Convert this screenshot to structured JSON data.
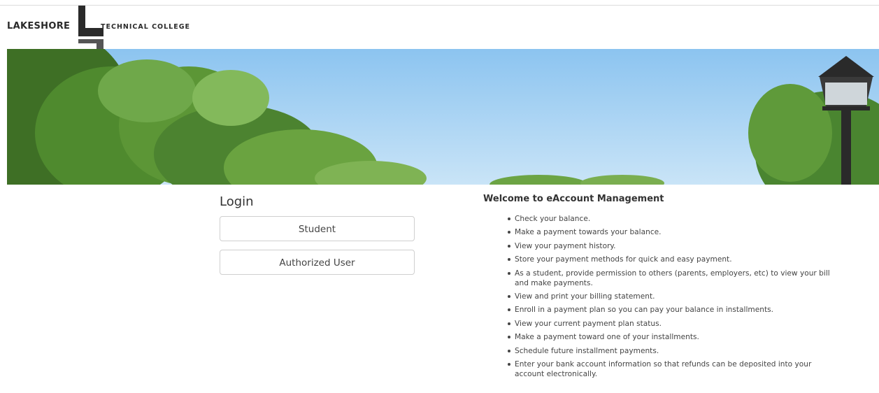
{
  "header": {
    "logo_left": "LAKESHORE",
    "logo_right": "TECHNICAL COLLEGE"
  },
  "banner": {
    "description_icon": "campus-trees-photo"
  },
  "login": {
    "title": "Login",
    "student_label": "Student",
    "authorized_label": "Authorized User"
  },
  "welcome": {
    "title": "Welcome to eAccount Management",
    "items": [
      "Check your balance.",
      "Make a payment towards your balance.",
      "View your payment history.",
      "Store your payment methods for quick and easy payment.",
      "As a student, provide permission to others (parents, employers, etc) to view your bill and make payments.",
      "View and print your billing statement.",
      "Enroll in a payment plan so you can pay your balance in installments.",
      "View your current payment plan status.",
      "Make a payment toward one of your installments.",
      "Schedule future installment payments.",
      "Enter your bank account information so that refunds can be deposited into your account electronically."
    ]
  },
  "colors": {
    "sky": "#a9d3f5",
    "foliage": "#4f8a2e",
    "text": "#333333",
    "border": "#cfcfcf"
  }
}
